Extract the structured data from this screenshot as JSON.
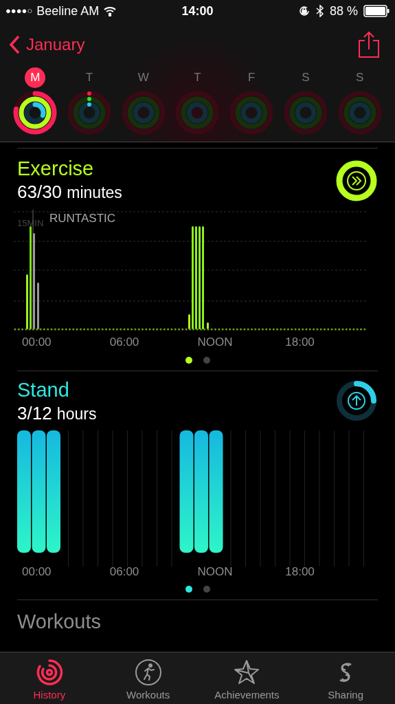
{
  "status_bar": {
    "signal_text": "●●●●○",
    "carrier": "Beeline AM",
    "time": "14:00",
    "battery": "88 %"
  },
  "nav": {
    "back_label": "January"
  },
  "days": [
    {
      "letter": "M",
      "selected": true,
      "kind": "active"
    },
    {
      "letter": "T",
      "selected": false,
      "kind": "started"
    },
    {
      "letter": "W",
      "selected": false,
      "kind": "empty"
    },
    {
      "letter": "T",
      "selected": false,
      "kind": "empty"
    },
    {
      "letter": "F",
      "selected": false,
      "kind": "empty"
    },
    {
      "letter": "S",
      "selected": false,
      "kind": "empty"
    },
    {
      "letter": "S",
      "selected": false,
      "kind": "empty"
    }
  ],
  "exercise": {
    "title": "Exercise",
    "value": "63/30",
    "unit": "minutes",
    "y_label": "15MIN",
    "workout_label": "RUNTASTIC",
    "x_labels": [
      "00:00",
      "06:00",
      "NOON",
      "18:00"
    ],
    "pages": [
      {
        "selected": true
      },
      {
        "selected": false
      }
    ]
  },
  "stand": {
    "title": "Stand",
    "value": "3/12",
    "unit": "hours",
    "x_labels": [
      "00:00",
      "06:00",
      "NOON",
      "18:00"
    ],
    "pages": [
      {
        "selected": true
      },
      {
        "selected": false
      }
    ]
  },
  "workouts": {
    "title": "Workouts"
  },
  "tabs": [
    {
      "label": "History",
      "selected": true
    },
    {
      "label": "Workouts",
      "selected": false
    },
    {
      "label": "Achievements",
      "selected": false
    },
    {
      "label": "Sharing",
      "selected": false
    }
  ]
}
